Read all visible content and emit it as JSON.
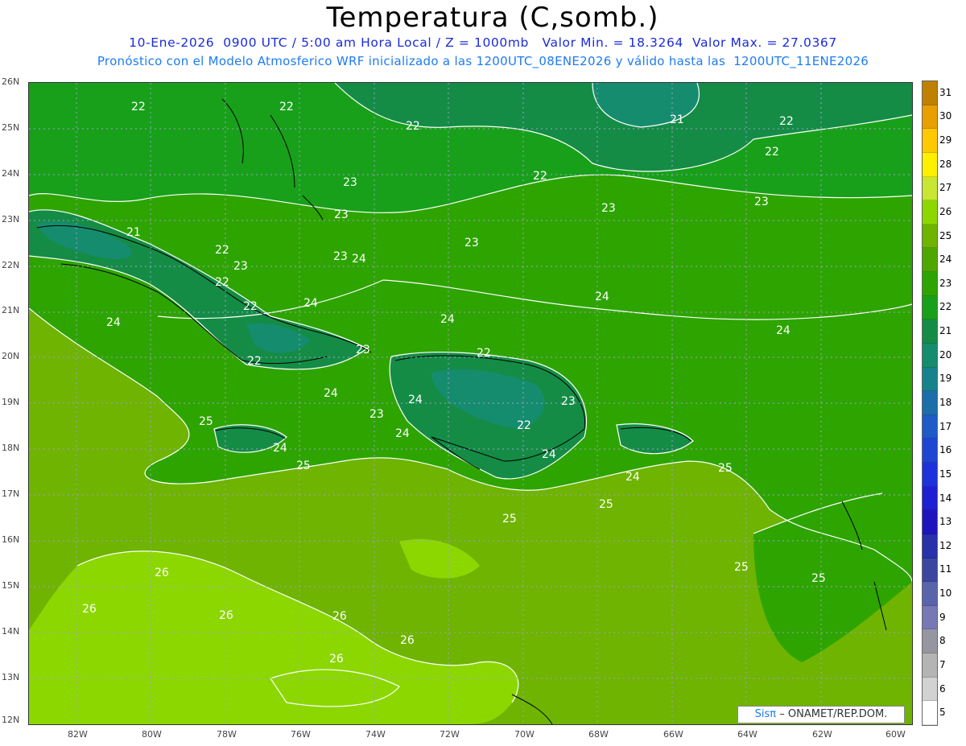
{
  "title": "Temperatura (C,somb.)",
  "subtitle": "10-Ene-2026  0900 UTC / 5:00 am Hora Local / Z = 1000mb   Valor Min. = 18.3264  Valor Max. = 27.0367",
  "subtitle2": "Pronóstico con el Modelo Atmosferico WRF inicializado a las 1200UTC_08ENE2026 y válido hasta las  1200UTC_11ENE2026",
  "lat_labels": [
    "26N",
    "25N",
    "24N",
    "23N",
    "22N",
    "21N",
    "20N",
    "19N",
    "18N",
    "17N",
    "16N",
    "15N",
    "14N",
    "13N",
    "12N"
  ],
  "lon_labels": [
    "82W",
    "80W",
    "78W",
    "76W",
    "74W",
    "72W",
    "70W",
    "68W",
    "66W",
    "64W",
    "62W",
    "60W"
  ],
  "colorbar": {
    "labels": [
      "31",
      "30",
      "29",
      "28",
      "27",
      "26",
      "25",
      "24",
      "23",
      "22",
      "21",
      "20",
      "19",
      "18",
      "17",
      "16",
      "15",
      "14",
      "13",
      "12",
      "11",
      "10",
      "9",
      "8",
      "7",
      "6",
      "5"
    ],
    "colors": [
      "#c08000",
      "#e8a000",
      "#ffc800",
      "#fff000",
      "#c8e632",
      "#8cd700",
      "#6eb400",
      "#4ea600",
      "#2ea400",
      "#18a01a",
      "#148c46",
      "#168c6e",
      "#16828c",
      "#1a6eaa",
      "#1e5ac8",
      "#1e46d2",
      "#1e32dc",
      "#1e1ed2",
      "#1e14be",
      "#2830aa",
      "#3c46a0",
      "#5a64aa",
      "#7878b4",
      "#9696a0",
      "#b4b4b4",
      "#d2d2d2",
      "#ffffff"
    ]
  },
  "contour_labels": [
    {
      "text": "22"
    },
    {
      "text": "22"
    },
    {
      "text": "22"
    },
    {
      "text": "22"
    },
    {
      "text": "21"
    },
    {
      "text": "22"
    },
    {
      "text": "22"
    },
    {
      "text": "23"
    },
    {
      "text": "23"
    },
    {
      "text": "23"
    },
    {
      "text": "23"
    },
    {
      "text": "23"
    },
    {
      "text": "21"
    },
    {
      "text": "22"
    },
    {
      "text": "23"
    },
    {
      "text": "22"
    },
    {
      "text": "24"
    },
    {
      "text": "22"
    },
    {
      "text": "24"
    },
    {
      "text": "24"
    },
    {
      "text": "24"
    },
    {
      "text": "24"
    },
    {
      "text": "24"
    },
    {
      "text": "23"
    },
    {
      "text": "22"
    },
    {
      "text": "22"
    },
    {
      "text": "24"
    },
    {
      "text": "23"
    },
    {
      "text": "24"
    },
    {
      "text": "23"
    },
    {
      "text": "25"
    },
    {
      "text": "24"
    },
    {
      "text": "25"
    },
    {
      "text": "24"
    },
    {
      "text": "22"
    },
    {
      "text": "24"
    },
    {
      "text": "24"
    },
    {
      "text": "25"
    },
    {
      "text": "25"
    },
    {
      "text": "25"
    },
    {
      "text": "25"
    },
    {
      "text": "25"
    },
    {
      "text": "26"
    },
    {
      "text": "26"
    },
    {
      "text": "26"
    },
    {
      "text": "26"
    },
    {
      "text": "26"
    },
    {
      "text": "26"
    },
    {
      "text": "23"
    }
  ],
  "colors": {
    "cold": "#168c6e",
    "cool": "#18a01a",
    "mild": "#2ea400",
    "warm": "#6eb400",
    "hot": "#8cd700",
    "contour": "#ffffff",
    "coast": "#000000"
  },
  "logo": {
    "sis": "Sisπ",
    "org": "– ONAMET/REP.DOM."
  }
}
